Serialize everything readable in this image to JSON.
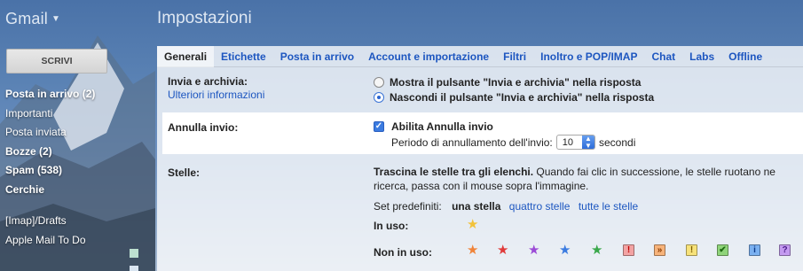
{
  "header": {
    "app_name": "Gmail",
    "page_title": "Impostazioni"
  },
  "sidebar": {
    "compose_label": "SCRIVI",
    "items": [
      {
        "label": "Posta in arrivo (2)",
        "bold": true
      },
      {
        "label": "Importanti",
        "bold": false
      },
      {
        "label": "Posta inviata",
        "bold": false
      },
      {
        "label": "Bozze (2)",
        "bold": true
      },
      {
        "label": "Spam (538)",
        "bold": true
      },
      {
        "label": "Cerchie",
        "bold": true
      }
    ],
    "labels": [
      {
        "label": "[Imap]/Drafts"
      },
      {
        "label": "Apple Mail To Do"
      }
    ]
  },
  "tabs": [
    {
      "label": "Generali",
      "active": true
    },
    {
      "label": "Etichette"
    },
    {
      "label": "Posta in arrivo"
    },
    {
      "label": "Account e importazione"
    },
    {
      "label": "Filtri"
    },
    {
      "label": "Inoltro e POP/IMAP"
    },
    {
      "label": "Chat"
    },
    {
      "label": "Labs"
    },
    {
      "label": "Offline"
    }
  ],
  "send_archive": {
    "label": "Invia e archivia:",
    "more_info": "Ulteriori informazioni",
    "option_show": "Mostra il pulsante \"Invia e archivia\" nella risposta",
    "option_hide": "Nascondi il pulsante \"Invia e archivia\" nella risposta",
    "selected": "hide"
  },
  "undo_send": {
    "label": "Annulla invio:",
    "enable_label": "Abilita Annulla invio",
    "enabled": true,
    "period_prefix": "Periodo di annullamento dell'invio:",
    "period_value": "10",
    "period_suffix": "secondi"
  },
  "stars": {
    "label": "Stelle:",
    "desc_bold": "Trascina le stelle tra gli elenchi.",
    "desc_1": " Quando fai clic in successione, le stelle ruotano ne",
    "desc_2": "ricerca, passa con il mouse sopra l'immagine.",
    "presets_label": "Set predefiniti:",
    "preset_one": "una stella",
    "preset_four": "quattro stelle",
    "preset_all": "tutte le stelle",
    "in_use_label": "In uso:",
    "not_in_use_label": "Non in uso:",
    "in_use": [
      {
        "icon": "yellow-star-icon",
        "color": "#f2c23a"
      }
    ],
    "not_in_use": [
      {
        "icon": "orange-star-icon",
        "color": "#f0843a"
      },
      {
        "icon": "red-star-icon",
        "color": "#e03a3a"
      },
      {
        "icon": "purple-star-icon",
        "color": "#9b4ad6"
      },
      {
        "icon": "blue-star-icon",
        "color": "#3b7be0"
      },
      {
        "icon": "green-star-icon",
        "color": "#3aa84a"
      }
    ],
    "not_in_use_squares": [
      {
        "icon": "red-bang-icon",
        "glyph": "!",
        "bg": "#f3a3a3",
        "fg": "#b00"
      },
      {
        "icon": "orange-guillemet-icon",
        "glyph": "»",
        "bg": "#f7b37a",
        "fg": "#8a3a00"
      },
      {
        "icon": "yellow-bang-icon",
        "glyph": "!",
        "bg": "#f7e27a",
        "fg": "#7a5a00"
      },
      {
        "icon": "green-check-icon",
        "glyph": "✔",
        "bg": "#8fd47a",
        "fg": "#1d6a10"
      },
      {
        "icon": "blue-info-icon",
        "glyph": "i",
        "bg": "#7ab0f0",
        "fg": "#0b3a8a"
      },
      {
        "icon": "purple-question-icon",
        "glyph": "?",
        "bg": "#c49af0",
        "fg": "#4a1a8a"
      }
    ]
  },
  "colors": {
    "link": "#1d56c0",
    "accent": "#3b7be0"
  }
}
